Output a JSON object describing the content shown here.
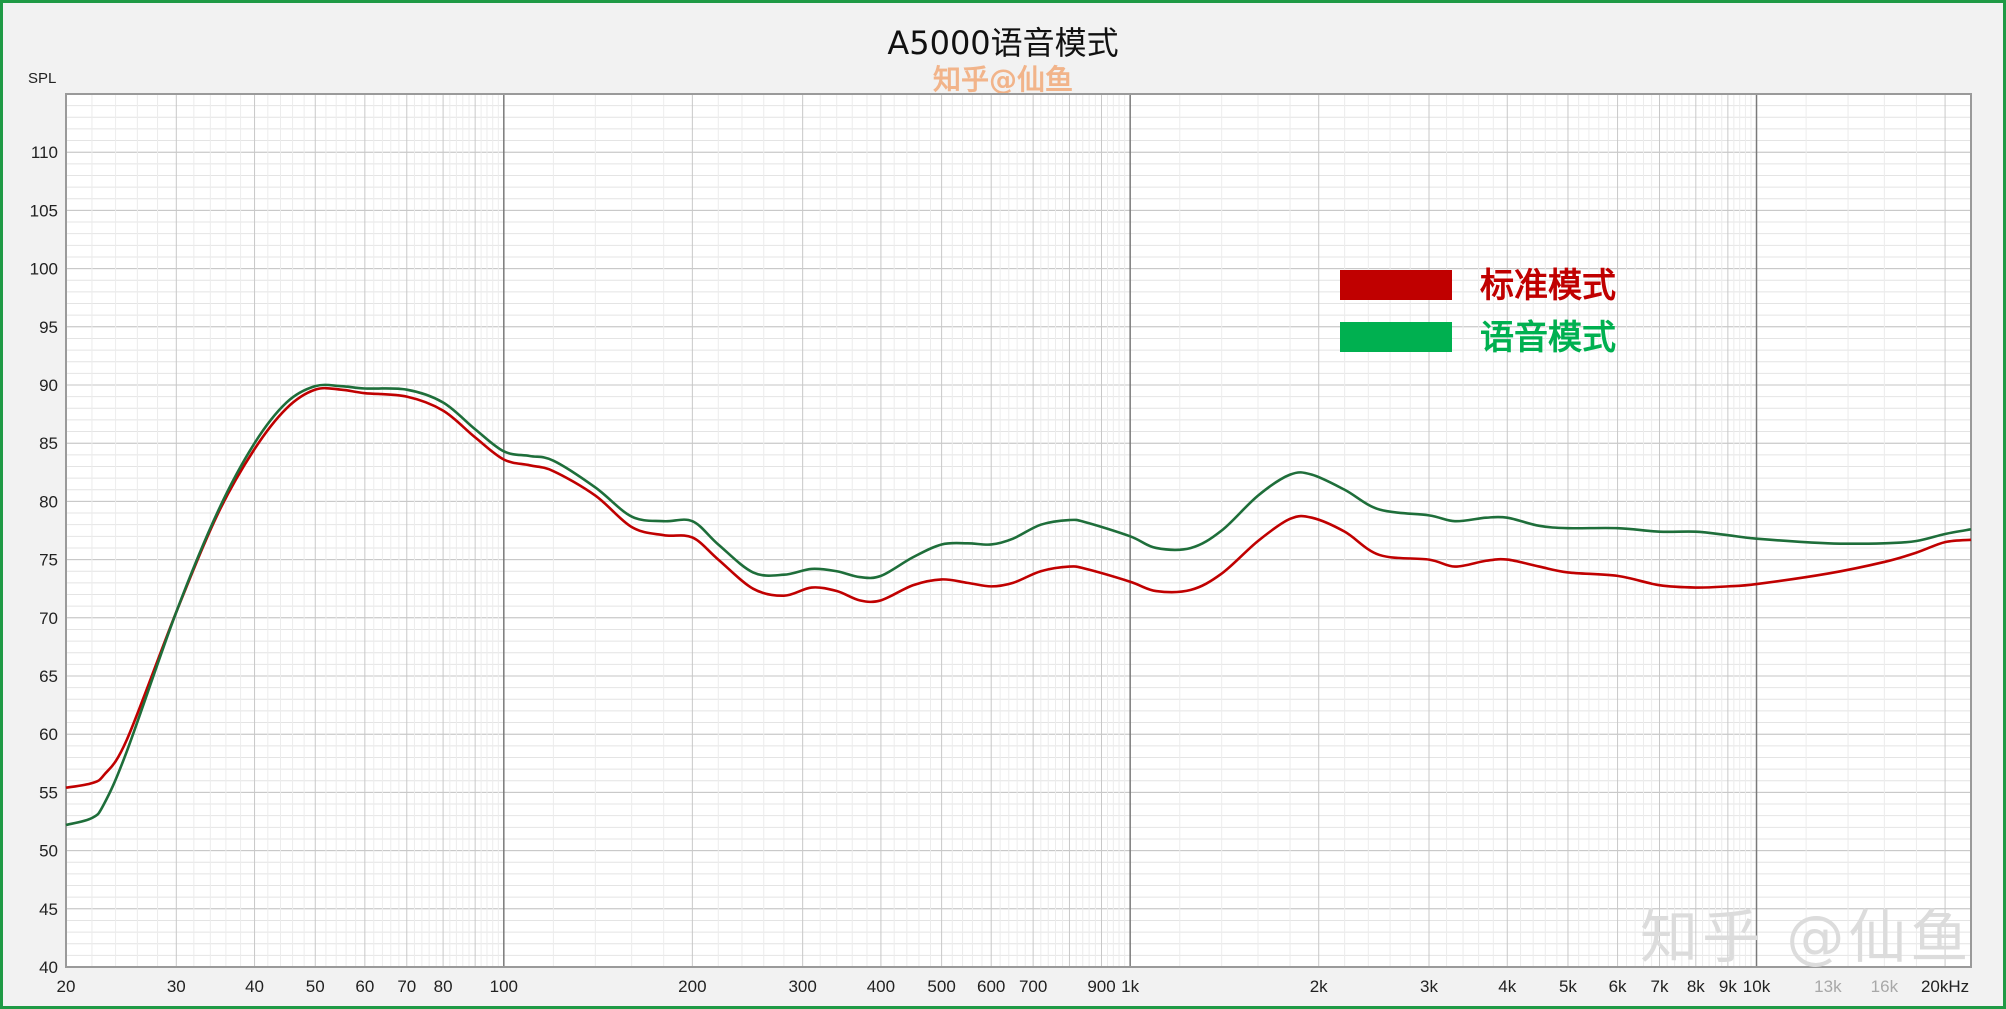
{
  "chart_data": {
    "type": "line",
    "title": "A5000语音模式",
    "watermark_top": "知乎@仙鱼",
    "watermark_corner": "知乎 @仙鱼",
    "ylabel": "SPL",
    "xlabel": "",
    "x_scale": "log",
    "xlim": [
      20,
      22000
    ],
    "ylim": [
      40,
      115
    ],
    "grid": true,
    "legend_position": "top-right",
    "y_ticks": [
      40,
      45,
      50,
      55,
      60,
      65,
      70,
      75,
      80,
      85,
      90,
      95,
      100,
      105,
      110
    ],
    "x_ticks": [
      {
        "v": 20,
        "label": "20"
      },
      {
        "v": 30,
        "label": "30"
      },
      {
        "v": 40,
        "label": "40"
      },
      {
        "v": 50,
        "label": "50"
      },
      {
        "v": 60,
        "label": "60"
      },
      {
        "v": 70,
        "label": "70"
      },
      {
        "v": 80,
        "label": "80"
      },
      {
        "v": 100,
        "label": "100"
      },
      {
        "v": 200,
        "label": "200"
      },
      {
        "v": 300,
        "label": "300"
      },
      {
        "v": 400,
        "label": "400"
      },
      {
        "v": 500,
        "label": "500"
      },
      {
        "v": 600,
        "label": "600"
      },
      {
        "v": 700,
        "label": "700"
      },
      {
        "v": 900,
        "label": "900"
      },
      {
        "v": 1000,
        "label": "1k"
      },
      {
        "v": 2000,
        "label": "2k"
      },
      {
        "v": 3000,
        "label": "3k"
      },
      {
        "v": 4000,
        "label": "4k"
      },
      {
        "v": 5000,
        "label": "5k"
      },
      {
        "v": 6000,
        "label": "6k"
      },
      {
        "v": 7000,
        "label": "7k"
      },
      {
        "v": 8000,
        "label": "8k"
      },
      {
        "v": 9000,
        "label": "9k"
      },
      {
        "v": 10000,
        "label": "10k"
      },
      {
        "v": 13000,
        "label": "13k",
        "dim": true
      },
      {
        "v": 16000,
        "label": "16k",
        "dim": true
      },
      {
        "v": 20000,
        "label": "20kHz"
      }
    ],
    "series": [
      {
        "name": "标准模式",
        "color": "#c00000",
        "points": [
          [
            20,
            55.4
          ],
          [
            22,
            55.8
          ],
          [
            23,
            56.5
          ],
          [
            25,
            59.5
          ],
          [
            30,
            70.5
          ],
          [
            35,
            79
          ],
          [
            40,
            84.5
          ],
          [
            45,
            88
          ],
          [
            50,
            89.6
          ],
          [
            55,
            89.6
          ],
          [
            60,
            89.3
          ],
          [
            70,
            89.0
          ],
          [
            80,
            87.8
          ],
          [
            90,
            85.5
          ],
          [
            100,
            83.6
          ],
          [
            110,
            83.1
          ],
          [
            120,
            82.6
          ],
          [
            140,
            80.5
          ],
          [
            160,
            77.8
          ],
          [
            180,
            77.1
          ],
          [
            200,
            76.9
          ],
          [
            220,
            75.0
          ],
          [
            250,
            72.5
          ],
          [
            280,
            71.9
          ],
          [
            310,
            72.6
          ],
          [
            340,
            72.3
          ],
          [
            370,
            71.5
          ],
          [
            400,
            71.5
          ],
          [
            450,
            72.8
          ],
          [
            500,
            73.3
          ],
          [
            550,
            73.0
          ],
          [
            600,
            72.7
          ],
          [
            650,
            73.0
          ],
          [
            720,
            74.0
          ],
          [
            800,
            74.4
          ],
          [
            850,
            74.2
          ],
          [
            1000,
            73.1
          ],
          [
            1100,
            72.3
          ],
          [
            1250,
            72.4
          ],
          [
            1400,
            73.8
          ],
          [
            1600,
            76.6
          ],
          [
            1800,
            78.5
          ],
          [
            1950,
            78.6
          ],
          [
            2200,
            77.4
          ],
          [
            2500,
            75.4
          ],
          [
            3000,
            75.0
          ],
          [
            3300,
            74.4
          ],
          [
            3700,
            74.9
          ],
          [
            4000,
            75.0
          ],
          [
            4500,
            74.4
          ],
          [
            5000,
            73.9
          ],
          [
            6000,
            73.6
          ],
          [
            7000,
            72.8
          ],
          [
            8000,
            72.6
          ],
          [
            9000,
            72.7
          ],
          [
            10000,
            72.9
          ],
          [
            13000,
            73.8
          ],
          [
            16000,
            74.8
          ],
          [
            18000,
            75.6
          ],
          [
            20000,
            76.5
          ],
          [
            22000,
            76.7
          ]
        ]
      },
      {
        "name": "语音模式",
        "color": "#1e6e3a",
        "points": [
          [
            20,
            52.2
          ],
          [
            22,
            52.8
          ],
          [
            23,
            54.0
          ],
          [
            25,
            58.5
          ],
          [
            30,
            70.5
          ],
          [
            35,
            79.2
          ],
          [
            40,
            85.0
          ],
          [
            45,
            88.5
          ],
          [
            50,
            89.9
          ],
          [
            55,
            89.9
          ],
          [
            60,
            89.7
          ],
          [
            70,
            89.6
          ],
          [
            80,
            88.5
          ],
          [
            90,
            86.2
          ],
          [
            100,
            84.3
          ],
          [
            110,
            83.9
          ],
          [
            120,
            83.5
          ],
          [
            140,
            81.2
          ],
          [
            160,
            78.7
          ],
          [
            180,
            78.3
          ],
          [
            200,
            78.3
          ],
          [
            220,
            76.3
          ],
          [
            250,
            73.9
          ],
          [
            280,
            73.7
          ],
          [
            310,
            74.2
          ],
          [
            340,
            74.0
          ],
          [
            370,
            73.5
          ],
          [
            400,
            73.6
          ],
          [
            450,
            75.2
          ],
          [
            500,
            76.3
          ],
          [
            550,
            76.4
          ],
          [
            600,
            76.3
          ],
          [
            650,
            76.8
          ],
          [
            720,
            78.0
          ],
          [
            800,
            78.4
          ],
          [
            850,
            78.2
          ],
          [
            1000,
            77.0
          ],
          [
            1100,
            76.0
          ],
          [
            1250,
            76.0
          ],
          [
            1400,
            77.5
          ],
          [
            1600,
            80.5
          ],
          [
            1800,
            82.3
          ],
          [
            1950,
            82.3
          ],
          [
            2200,
            81.0
          ],
          [
            2500,
            79.3
          ],
          [
            3000,
            78.8
          ],
          [
            3300,
            78.3
          ],
          [
            3700,
            78.6
          ],
          [
            4000,
            78.6
          ],
          [
            4500,
            77.9
          ],
          [
            5000,
            77.7
          ],
          [
            6000,
            77.7
          ],
          [
            7000,
            77.4
          ],
          [
            8000,
            77.4
          ],
          [
            9000,
            77.1
          ],
          [
            10000,
            76.8
          ],
          [
            13000,
            76.4
          ],
          [
            16000,
            76.4
          ],
          [
            18000,
            76.6
          ],
          [
            20000,
            77.2
          ],
          [
            22000,
            77.6
          ]
        ]
      }
    ]
  }
}
